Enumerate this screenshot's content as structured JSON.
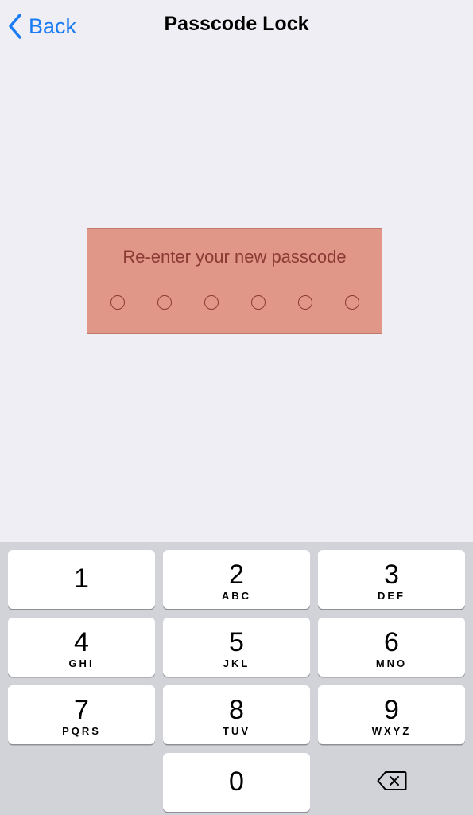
{
  "nav": {
    "back_label": "Back",
    "title": "Passcode Lock"
  },
  "prompt": {
    "text": "Re-enter your new passcode",
    "digit_count": 6,
    "filled": 0
  },
  "keypad": {
    "keys": [
      {
        "digit": "1",
        "letters": ""
      },
      {
        "digit": "2",
        "letters": "ABC"
      },
      {
        "digit": "3",
        "letters": "DEF"
      },
      {
        "digit": "4",
        "letters": "GHI"
      },
      {
        "digit": "5",
        "letters": "JKL"
      },
      {
        "digit": "6",
        "letters": "MNO"
      },
      {
        "digit": "7",
        "letters": "PQRS"
      },
      {
        "digit": "8",
        "letters": "TUV"
      },
      {
        "digit": "9",
        "letters": "WXYZ"
      },
      {
        "digit": "0",
        "letters": ""
      }
    ],
    "delete_icon": "backspace-icon"
  },
  "colors": {
    "accent": "#1a7cf5",
    "background": "#efeef4",
    "prompt_box": "#e09788",
    "prompt_text": "#8b3a33",
    "keypad_background": "#d1d3d9",
    "key_background": "#ffffff"
  }
}
